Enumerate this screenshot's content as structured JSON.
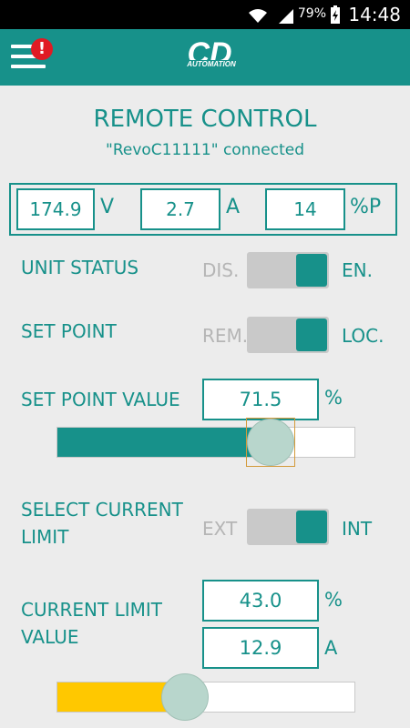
{
  "status_bar": {
    "battery": "79%",
    "time": "14:48"
  },
  "header": {
    "title": "REMOTE CONTROL",
    "subtitle": "\"RevoC11111\" connected",
    "logo_text": "CD",
    "logo_sub": "AUTOMATION",
    "alert_badge": "!"
  },
  "readings": [
    {
      "value": "174.9",
      "unit": "V"
    },
    {
      "value": "2.7",
      "unit": "A"
    },
    {
      "value": "14",
      "unit": "%P"
    }
  ],
  "unit_status": {
    "label": "UNIT STATUS",
    "off_label": "DIS.",
    "on_label": "EN.",
    "state": "on"
  },
  "set_point": {
    "label": "SET POINT",
    "off_label": "REM.",
    "on_label": "LOC.",
    "state": "on"
  },
  "set_point_value": {
    "label": "SET POINT VALUE",
    "value": "71.5",
    "unit": "%",
    "slider_fraction": 0.715,
    "color": "#17918a"
  },
  "current_limit_select": {
    "label_line1": "SELECT CURRENT",
    "label_line2": "LIMIT",
    "off_label": "EXT",
    "on_label": "INT",
    "state": "on"
  },
  "current_limit_value": {
    "label_line1": "CURRENT LIMIT",
    "label_line2": "VALUE",
    "percent_value": "43.0",
    "percent_unit": "%",
    "amp_value": "12.9",
    "amp_unit": "A",
    "slider_fraction": 0.43,
    "color": "#ffc800"
  },
  "colors": {
    "accent": "#17918a",
    "alert": "#e01b24",
    "background": "#ececec"
  }
}
